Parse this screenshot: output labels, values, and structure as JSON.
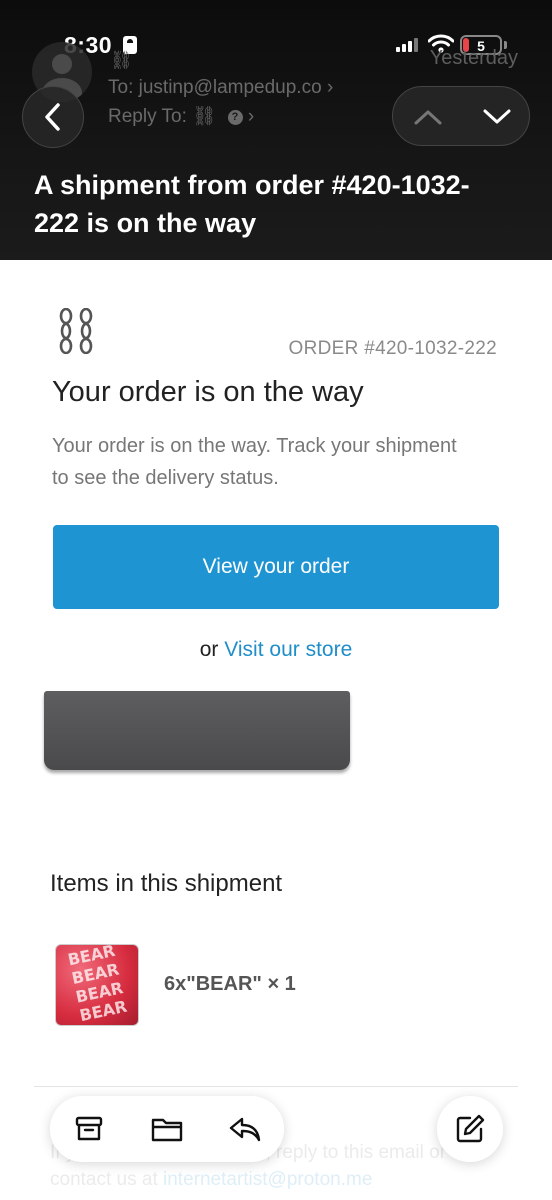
{
  "status_bar": {
    "time": "8:30",
    "battery": "5"
  },
  "message_header": {
    "sender_glyph": "⛓",
    "date": "Yesterday",
    "to_label": "To:",
    "to_value": "justinp@lampedup.co",
    "reply_to_label": "Reply To:",
    "reply_to_glyph": "⛓"
  },
  "subject": "A shipment from order #420-1032-222 is on the way",
  "email": {
    "order_number": "ORDER #420-1032-222",
    "headline": "Your order is on the way",
    "body": "Your order is on the way. Track your shipment to see the delivery status.",
    "view_order_label": "View your order",
    "or_text": "or",
    "visit_store_label": "Visit our store",
    "items_heading": "Items in this shipment",
    "items": [
      {
        "name": "6x\"BEAR\" × 1",
        "thumb_text": "BEAR BEAR BEAR BEAR"
      }
    ],
    "footer_prefix": "If you have any questions, reply to this email or",
    "footer_contact": "contact us at",
    "footer_email": "internetartist@proton.me"
  },
  "icons": {
    "back": "chevron-left-icon",
    "prev": "chevron-up-icon",
    "next": "chevron-down-icon",
    "archive": "archive-icon",
    "move": "folder-icon",
    "reply": "reply-icon",
    "compose": "compose-icon"
  },
  "colors": {
    "button": "#1f94d2",
    "link": "#1f8ec9",
    "header_bg": "#161616"
  }
}
